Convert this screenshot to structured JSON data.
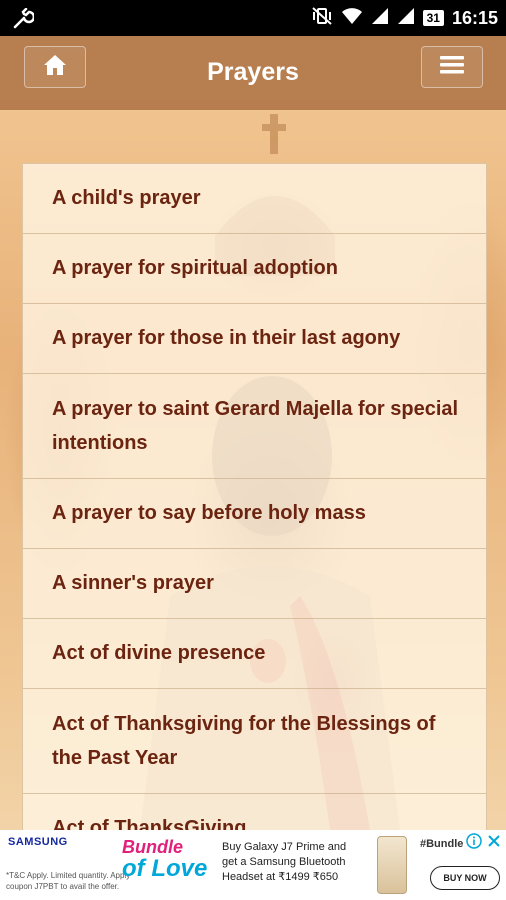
{
  "status_bar": {
    "battery_level": "31",
    "time": "16:15"
  },
  "app_bar": {
    "title": "Prayers",
    "home_icon": "home-icon",
    "menu_icon": "hamburger-menu-icon"
  },
  "prayers": [
    "A child's prayer",
    "A prayer for spiritual adoption",
    "A prayer for those in their last agony",
    "A prayer to saint Gerard Majella for special intentions",
    "A prayer to say before holy mass",
    "A sinner's prayer",
    "Act of divine presence",
    "Act of Thanksgiving for the Blessings of the Past Year",
    "Act of ThanksGiving"
  ],
  "ad": {
    "brand": "SAMSUNG",
    "fine_print": "*T&C Apply. Limited quantity. Apply coupon J7PBT to avail the offer.",
    "campaign_line1": "Bundle",
    "campaign_line2": "of Love",
    "copy": "Buy Galaxy J7 Prime and get a Samsung Bluetooth Headset at ₹1499 ₹650",
    "hashtag": "#Bundle",
    "cta": "BUY NOW"
  },
  "colors": {
    "appbar": "#aa6e41",
    "list_text": "#6b2410",
    "status_bar": "#000000"
  }
}
